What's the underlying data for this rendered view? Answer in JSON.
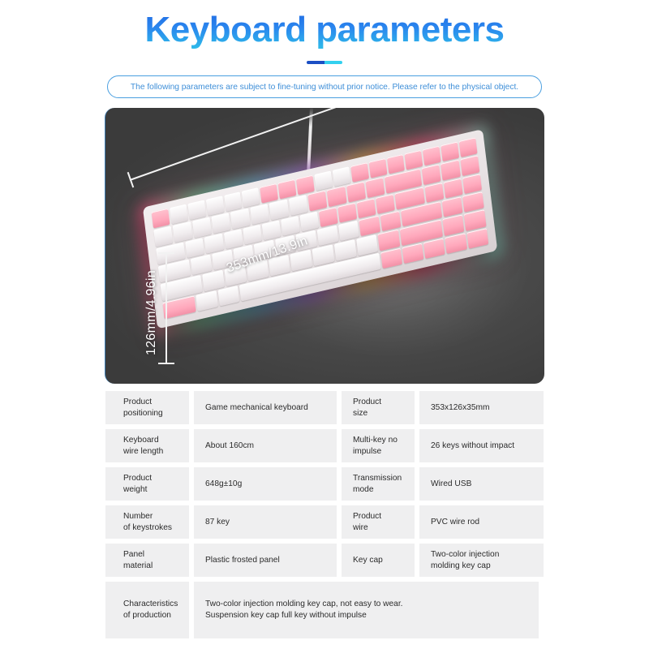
{
  "header": {
    "title": "Keyboard parameters",
    "notice": "The following parameters are subject to fine-tuning without prior notice. Please refer to the physical object."
  },
  "hero": {
    "width_label": "353mm/13.9in",
    "height_label": "126mm/4.96in",
    "product_image": "pink-white-rgb-mechanical-keyboard"
  },
  "colors": {
    "title_gradient_start": "#1f64e0",
    "title_gradient_end": "#2fc8e8",
    "notice_border": "#4a9fe0",
    "notice_text": "#3f8fd8",
    "hero_background": "#454545",
    "cell_background": "#efeff0",
    "cell_text": "#2b2b2b"
  },
  "spec_table": {
    "rows": [
      {
        "label1_line1": "Product",
        "label1_line2": "positioning",
        "value1": "Game mechanical keyboard",
        "label2_line1": "Product",
        "label2_line2": "size",
        "value2": "353x126x35mm"
      },
      {
        "label1_line1": "Keyboard",
        "label1_line2": "wire length",
        "value1": "About 160cm",
        "label2_line1": "Multi-key no",
        "label2_line2": "impulse",
        "value2": "26 keys without impact"
      },
      {
        "label1_line1": "Product",
        "label1_line2": "weight",
        "value1": "648g±10g",
        "label2_line1": "Transmission",
        "label2_line2": "mode",
        "value2": "Wired USB"
      },
      {
        "label1_line1": "Number",
        "label1_line2": "of keystrokes",
        "value1": "87 key",
        "label2_line1": "Product",
        "label2_line2": "wire",
        "value2": "PVC wire rod"
      },
      {
        "label1_line1": "Panel",
        "label1_line2": "material",
        "value1": "Plastic frosted panel",
        "label2_line1": "Key cap",
        "label2_line2": "",
        "value2_line1": "Two-color injection",
        "value2_line2": "molding key cap"
      }
    ],
    "last_row": {
      "label_line1": "Characteristics",
      "label_line2": "of production",
      "value_line1": "Two-color injection molding key cap, not easy to wear.",
      "value_line2": "Suspension key cap full key without impulse"
    }
  }
}
